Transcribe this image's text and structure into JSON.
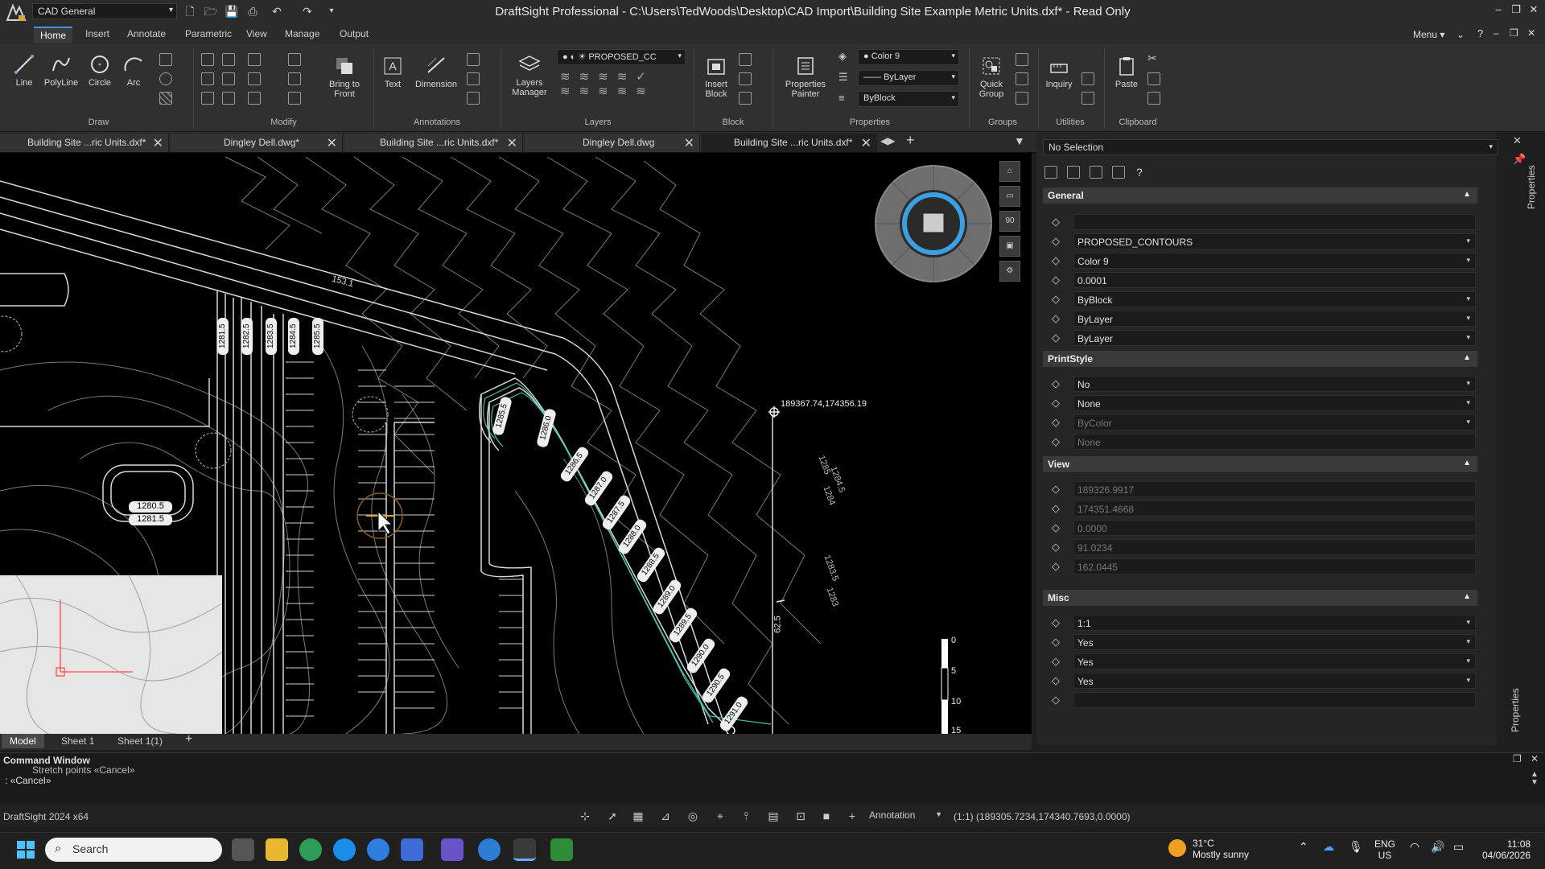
{
  "titlebar": {
    "workspace": "CAD General",
    "title": "DraftSight Professional - C:\\Users\\TedWoods\\Desktop\\CAD Import\\Building Site Example Metric Units.dxf* - Read Only"
  },
  "ribbon_tabs": [
    "Home",
    "Insert",
    "Annotate",
    "Parametric",
    "View",
    "Manage",
    "Output"
  ],
  "menu_label": "Menu",
  "ribbon": {
    "draw": {
      "label": "Draw",
      "buttons": [
        "Line",
        "PolyLine",
        "Circle",
        "Arc"
      ]
    },
    "modify": {
      "label": "Modify",
      "buttons": [
        "Bring to Front"
      ]
    },
    "annotations": {
      "label": "Annotations",
      "buttons": [
        "Text",
        "Dimension"
      ]
    },
    "layers": {
      "label": "Layers",
      "buttons": [
        "Layers Manager"
      ],
      "current": "PROPOSED_CC"
    },
    "block": {
      "label": "Block",
      "buttons": [
        "Insert Block"
      ]
    },
    "properties": {
      "label": "Properties",
      "buttons": [
        "Properties Painter"
      ],
      "color": "Color 9",
      "linetype": "ByLayer",
      "lineweight": "ByBlock"
    },
    "groups": {
      "label": "Groups",
      "buttons": [
        "Quick Group"
      ]
    },
    "utilities": {
      "label": "Utilities",
      "buttons": [
        "Inquiry"
      ]
    },
    "clipboard": {
      "label": "Clipboard",
      "buttons": [
        "Paste"
      ]
    }
  },
  "doc_tabs": [
    "Building Site ...ric Units.dxf*",
    "Dingley Dell.dwg*",
    "Building Site ...ric Units.dxf*",
    "Dingley Dell.dwg",
    "Building Site ...ric Units.dxf*"
  ],
  "drawing": {
    "labels": {
      "contour_top": "153.1",
      "coord": "189367.74,174356.19",
      "dim_right": "62.5",
      "pool_a": "1280.5",
      "pool_b": "1281.5",
      "right_a": "1285",
      "right_b": "1284.5",
      "right_c": "1284",
      "right_d": "1283.5",
      "right_e": "1283"
    },
    "spot_vertical": [
      "1281.5",
      "1282.5",
      "1283.5",
      "1284.5",
      "1285.5"
    ],
    "spot_ramp": [
      "1285.5",
      "1286.0",
      "1286.5",
      "1287.0",
      "1287.5",
      "1288.0",
      "1288.5",
      "1289.0",
      "1289.5",
      "1290.0",
      "1290.5",
      "1291.0"
    ],
    "scale_ticks": [
      "0",
      "5",
      "10",
      "15"
    ]
  },
  "layout_tabs": [
    "Model",
    "Sheet 1",
    "Sheet 1(1)"
  ],
  "properties": {
    "selection": "No Selection",
    "sections": {
      "general": "General",
      "printstyle": "PrintStyle",
      "view": "View",
      "misc": "Misc"
    },
    "general": [
      "",
      "PROPOSED_CONTOURS",
      "Color 9",
      "0.0001",
      "ByBlock",
      "ByLayer",
      "ByLayer"
    ],
    "printstyle": [
      "No",
      "None",
      "ByColor",
      "None"
    ],
    "view": [
      "189326.9917",
      "174351.4668",
      "0.0000",
      "91.0234",
      "162.0445"
    ],
    "misc": [
      "1:1",
      "Yes",
      "Yes",
      "Yes",
      ""
    ]
  },
  "panel_tab": "Properties",
  "command": {
    "title": "Command Window",
    "line1": "Stretch points «Cancel»",
    "line2": ": «Cancel»"
  },
  "status": {
    "app": "DraftSight 2024 x64",
    "annotation": "Annotation",
    "scale_coords": "(1:1)  (189305.7234,174340.7693,0.0000)"
  },
  "taskbar": {
    "search": "Search",
    "weather_temp": "31°C",
    "weather_desc": "Mostly sunny",
    "lang1": "ENG",
    "lang2": "US",
    "time": "11:08",
    "date": "04/06/2026"
  }
}
